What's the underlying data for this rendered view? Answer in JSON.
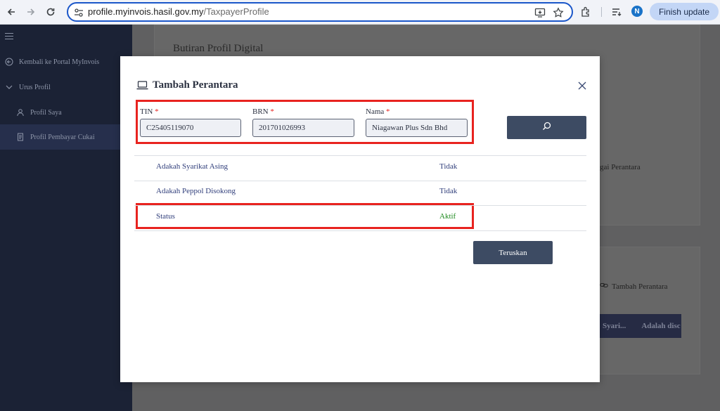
{
  "browser": {
    "url_host": "profile.myinvois.hasil.gov.my",
    "url_path": "/TaxpayerProfile",
    "profile_initial": "N",
    "finish_update_label": "Finish update"
  },
  "sidebar": {
    "items": [
      {
        "label": "Kembali ke Portal MyInvois"
      },
      {
        "label": "Urus Profil"
      },
      {
        "label": "Profil Saya"
      },
      {
        "label": "Profil Pembayar Cukai"
      }
    ]
  },
  "background": {
    "heading": "Butiran Profil Digital",
    "fragment_intermediary": "gai Perantara",
    "add_intermediary": "Tambah Perantara",
    "tab1": "Syari...",
    "tab2": "Adalah disc"
  },
  "modal": {
    "title": "Tambah Perantara",
    "fields": [
      {
        "label": "TIN",
        "required_mark": "*",
        "value": "C25405119070"
      },
      {
        "label": "BRN",
        "required_mark": "*",
        "value": "201701026993"
      },
      {
        "label": "Nama",
        "required_mark": "*",
        "value": "Niagawan Plus Sdn Bhd"
      }
    ],
    "rows": [
      {
        "label": "Adakah Syarikat Asing",
        "value": "Tidak"
      },
      {
        "label": "Adakah Peppol Disokong",
        "value": "Tidak"
      },
      {
        "label": "Status",
        "value": "Aktif"
      }
    ],
    "continue_label": "Teruskan"
  },
  "colors": {
    "highlight": "#e8231f",
    "primary_button": "#3d4b63",
    "status_active": "#1e8a1e",
    "sidebar": "#1b2235"
  }
}
